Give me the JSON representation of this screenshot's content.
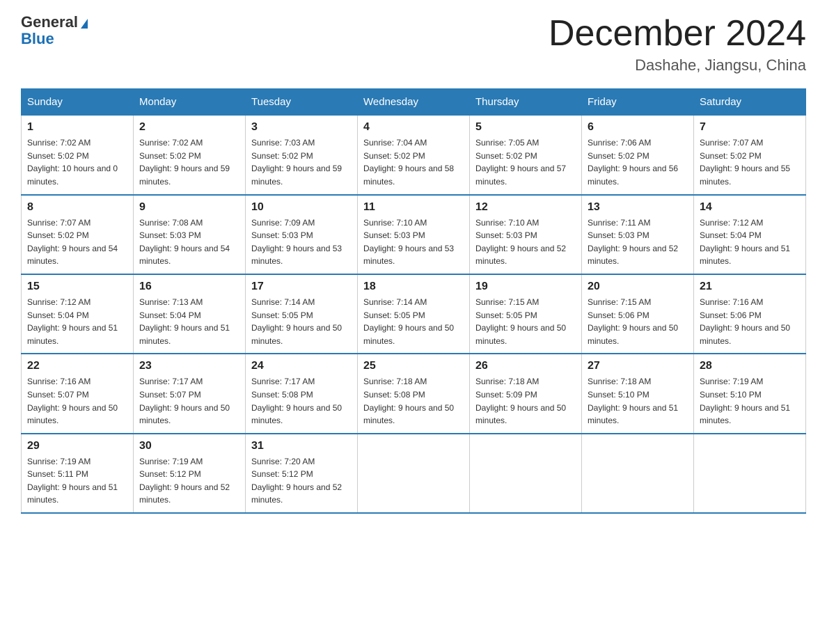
{
  "header": {
    "logo_line1": "General",
    "logo_line2": "Blue",
    "month_title": "December 2024",
    "location": "Dashahe, Jiangsu, China"
  },
  "days_of_week": [
    "Sunday",
    "Monday",
    "Tuesday",
    "Wednesday",
    "Thursday",
    "Friday",
    "Saturday"
  ],
  "weeks": [
    [
      {
        "day": "1",
        "sunrise": "7:02 AM",
        "sunset": "5:02 PM",
        "daylight": "10 hours and 0 minutes."
      },
      {
        "day": "2",
        "sunrise": "7:02 AM",
        "sunset": "5:02 PM",
        "daylight": "9 hours and 59 minutes."
      },
      {
        "day": "3",
        "sunrise": "7:03 AM",
        "sunset": "5:02 PM",
        "daylight": "9 hours and 59 minutes."
      },
      {
        "day": "4",
        "sunrise": "7:04 AM",
        "sunset": "5:02 PM",
        "daylight": "9 hours and 58 minutes."
      },
      {
        "day": "5",
        "sunrise": "7:05 AM",
        "sunset": "5:02 PM",
        "daylight": "9 hours and 57 minutes."
      },
      {
        "day": "6",
        "sunrise": "7:06 AM",
        "sunset": "5:02 PM",
        "daylight": "9 hours and 56 minutes."
      },
      {
        "day": "7",
        "sunrise": "7:07 AM",
        "sunset": "5:02 PM",
        "daylight": "9 hours and 55 minutes."
      }
    ],
    [
      {
        "day": "8",
        "sunrise": "7:07 AM",
        "sunset": "5:02 PM",
        "daylight": "9 hours and 54 minutes."
      },
      {
        "day": "9",
        "sunrise": "7:08 AM",
        "sunset": "5:03 PM",
        "daylight": "9 hours and 54 minutes."
      },
      {
        "day": "10",
        "sunrise": "7:09 AM",
        "sunset": "5:03 PM",
        "daylight": "9 hours and 53 minutes."
      },
      {
        "day": "11",
        "sunrise": "7:10 AM",
        "sunset": "5:03 PM",
        "daylight": "9 hours and 53 minutes."
      },
      {
        "day": "12",
        "sunrise": "7:10 AM",
        "sunset": "5:03 PM",
        "daylight": "9 hours and 52 minutes."
      },
      {
        "day": "13",
        "sunrise": "7:11 AM",
        "sunset": "5:03 PM",
        "daylight": "9 hours and 52 minutes."
      },
      {
        "day": "14",
        "sunrise": "7:12 AM",
        "sunset": "5:04 PM",
        "daylight": "9 hours and 51 minutes."
      }
    ],
    [
      {
        "day": "15",
        "sunrise": "7:12 AM",
        "sunset": "5:04 PM",
        "daylight": "9 hours and 51 minutes."
      },
      {
        "day": "16",
        "sunrise": "7:13 AM",
        "sunset": "5:04 PM",
        "daylight": "9 hours and 51 minutes."
      },
      {
        "day": "17",
        "sunrise": "7:14 AM",
        "sunset": "5:05 PM",
        "daylight": "9 hours and 50 minutes."
      },
      {
        "day": "18",
        "sunrise": "7:14 AM",
        "sunset": "5:05 PM",
        "daylight": "9 hours and 50 minutes."
      },
      {
        "day": "19",
        "sunrise": "7:15 AM",
        "sunset": "5:05 PM",
        "daylight": "9 hours and 50 minutes."
      },
      {
        "day": "20",
        "sunrise": "7:15 AM",
        "sunset": "5:06 PM",
        "daylight": "9 hours and 50 minutes."
      },
      {
        "day": "21",
        "sunrise": "7:16 AM",
        "sunset": "5:06 PM",
        "daylight": "9 hours and 50 minutes."
      }
    ],
    [
      {
        "day": "22",
        "sunrise": "7:16 AM",
        "sunset": "5:07 PM",
        "daylight": "9 hours and 50 minutes."
      },
      {
        "day": "23",
        "sunrise": "7:17 AM",
        "sunset": "5:07 PM",
        "daylight": "9 hours and 50 minutes."
      },
      {
        "day": "24",
        "sunrise": "7:17 AM",
        "sunset": "5:08 PM",
        "daylight": "9 hours and 50 minutes."
      },
      {
        "day": "25",
        "sunrise": "7:18 AM",
        "sunset": "5:08 PM",
        "daylight": "9 hours and 50 minutes."
      },
      {
        "day": "26",
        "sunrise": "7:18 AM",
        "sunset": "5:09 PM",
        "daylight": "9 hours and 50 minutes."
      },
      {
        "day": "27",
        "sunrise": "7:18 AM",
        "sunset": "5:10 PM",
        "daylight": "9 hours and 51 minutes."
      },
      {
        "day": "28",
        "sunrise": "7:19 AM",
        "sunset": "5:10 PM",
        "daylight": "9 hours and 51 minutes."
      }
    ],
    [
      {
        "day": "29",
        "sunrise": "7:19 AM",
        "sunset": "5:11 PM",
        "daylight": "9 hours and 51 minutes."
      },
      {
        "day": "30",
        "sunrise": "7:19 AM",
        "sunset": "5:12 PM",
        "daylight": "9 hours and 52 minutes."
      },
      {
        "day": "31",
        "sunrise": "7:20 AM",
        "sunset": "5:12 PM",
        "daylight": "9 hours and 52 minutes."
      },
      null,
      null,
      null,
      null
    ]
  ]
}
